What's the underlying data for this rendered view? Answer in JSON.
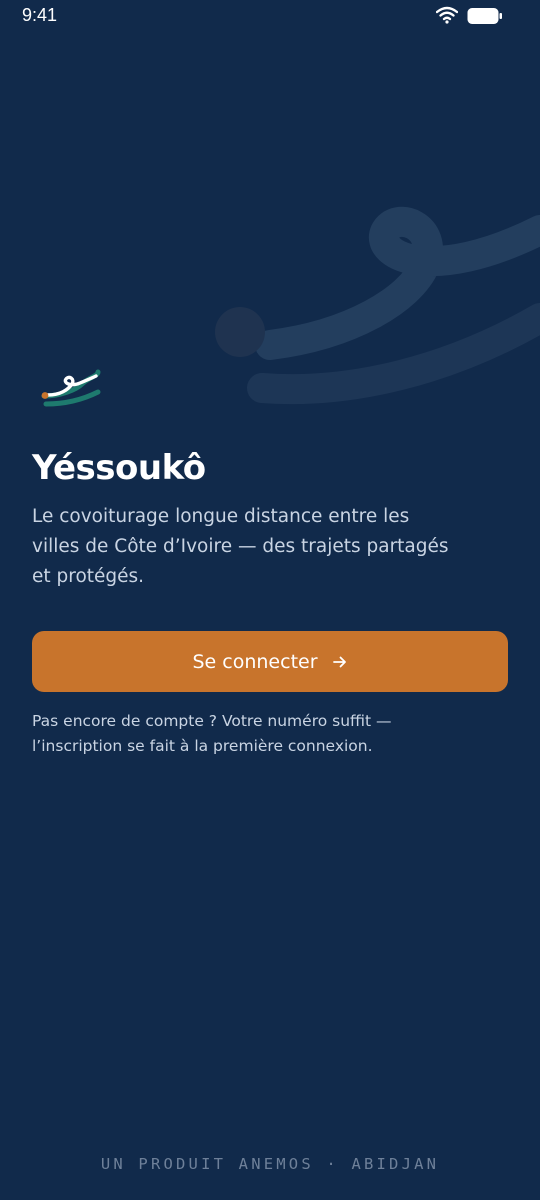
{
  "status_bar": {
    "time": "9:41",
    "wifi_icon": "wifi-icon",
    "battery_icon": "battery-icon"
  },
  "app": {
    "title": "Yéssoukô",
    "tagline": "Le covoiturage longue distance entre les villes de Côte d’Ivoire — des trajets partagés et protégés.",
    "logo_icon": "yessouko-logo"
  },
  "actions": {
    "connect_label": "Se connecter",
    "connect_icon": "arrow-right-icon"
  },
  "signup_hint": "Pas encore de compte ? Votre numéro suffit — l’inscription se fait à la première connexion.",
  "footer": {
    "credit": "UN PRODUIT ANEMOS · ABIDJAN"
  },
  "colors": {
    "background": "#112a4b",
    "accent": "#c8742c",
    "logo_teal": "#1e7a6e",
    "muted_text": "#c9d4e3",
    "footer_text": "#6e8099"
  }
}
